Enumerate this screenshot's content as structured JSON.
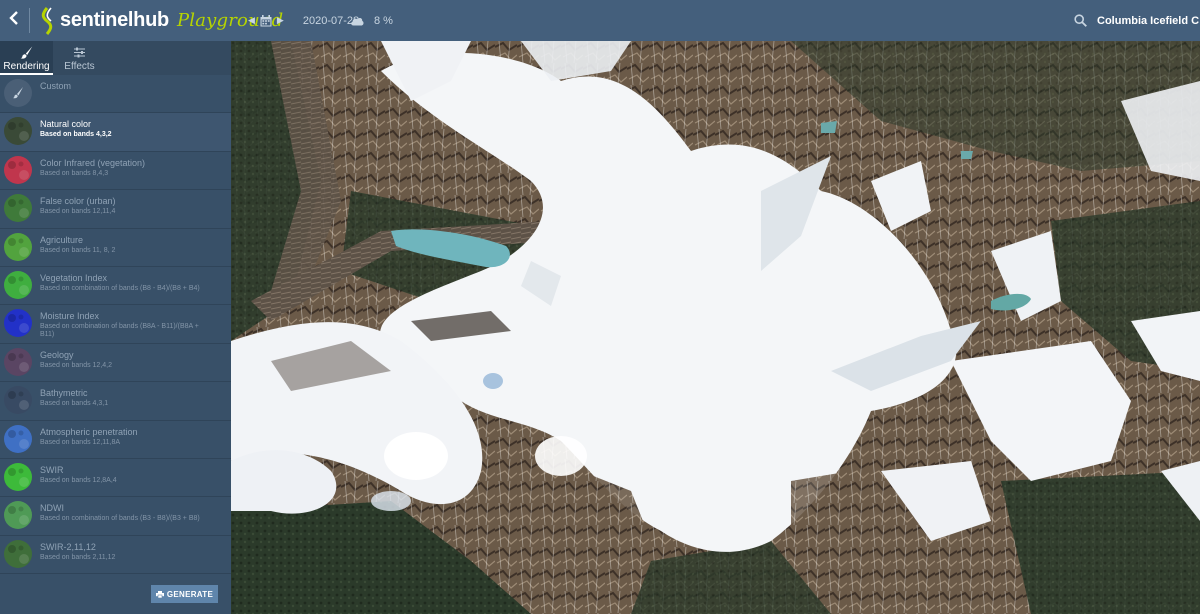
{
  "header": {
    "logo_text": "sentinelhub",
    "logo_subtitle": "Playground",
    "date": "2020-07-28",
    "cloud_coverage": "8 %",
    "search_value": "Columbia Icefield C",
    "icons": {
      "back": "chevron-left-icon",
      "prev_date": "caret-left-icon",
      "calendar": "calendar-icon",
      "next_date": "caret-right-icon",
      "cloud": "cloud-icon",
      "search": "search-icon"
    }
  },
  "sidebar": {
    "tabs": [
      {
        "label": "Rendering",
        "icon": "paintbrush-icon",
        "active": true
      },
      {
        "label": "Effects",
        "icon": "sliders-icon",
        "active": false
      }
    ],
    "layers": [
      {
        "name": "Custom",
        "description": "",
        "thumb_color": "#4a5f76",
        "active": false
      },
      {
        "name": "Natural color",
        "description": "Based on bands 4,3,2",
        "thumb_color": "#3a4a37",
        "active": true
      },
      {
        "name": "Color Infrared (vegetation)",
        "description": "Based on bands 8,4,3",
        "thumb_color": "#c0364d",
        "active": false
      },
      {
        "name": "False color (urban)",
        "description": "Based on bands 12,11,4",
        "thumb_color": "#3f7a3a",
        "active": false
      },
      {
        "name": "Agriculture",
        "description": "Based on bands 11, 8, 2",
        "thumb_color": "#52a33e",
        "active": false
      },
      {
        "name": "Vegetation Index",
        "description": "Based on combination of bands (B8 - B4)/(B8 + B4)",
        "thumb_color": "#3fae3f",
        "active": false
      },
      {
        "name": "Moisture Index",
        "description": "Based on combination of bands (B8A - B11)/(B8A + B11)",
        "thumb_color": "#2231c8",
        "active": false
      },
      {
        "name": "Geology",
        "description": "Based on bands 12,4,2",
        "thumb_color": "#5a4563",
        "active": false
      },
      {
        "name": "Bathymetric",
        "description": "Based on bands 4,3,1",
        "thumb_color": "#384a63",
        "active": false
      },
      {
        "name": "Atmospheric penetration",
        "description": "Based on bands 12,11,8A",
        "thumb_color": "#3f70c4",
        "active": false
      },
      {
        "name": "SWIR",
        "description": "Based on bands 12,8A,4",
        "thumb_color": "#3dba3a",
        "active": false
      },
      {
        "name": "NDWI",
        "description": "Based on combination of bands (B3 - B8)/(B3 + B8)",
        "thumb_color": "#4f9a56",
        "active": false
      },
      {
        "name": "SWIR-2,11,12",
        "description": "Based on bands 2,11,12",
        "thumb_color": "#3f6e3a",
        "active": false
      }
    ],
    "generate_button": {
      "label": "GENERATE",
      "icon": "printer-icon"
    }
  },
  "map": {
    "subject": "satellite image",
    "colors": {
      "snow": "#f4f6f8",
      "rock": "#6b5a48",
      "forest": "#2b3a2a",
      "lake": "#6fb5bd"
    }
  },
  "colors": {
    "topbar": "#445f7c",
    "sidebar": "#385068",
    "accent": "#b6d400",
    "button": "#5f85ab"
  }
}
